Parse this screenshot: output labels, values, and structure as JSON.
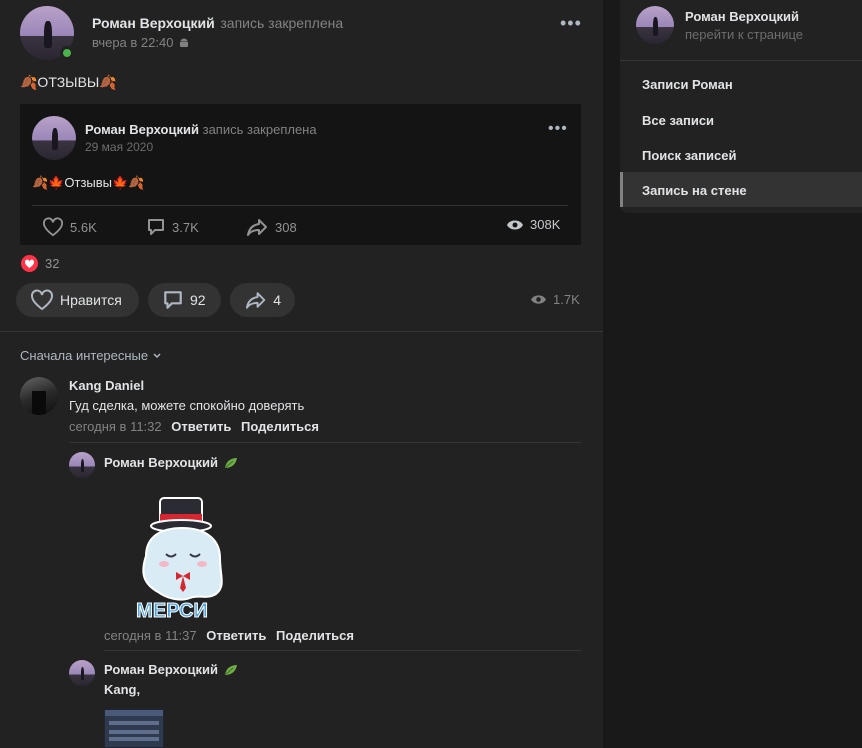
{
  "post": {
    "author": "Роман Верхоцкий",
    "action": "запись закреплена",
    "time": "вчера в 22:40",
    "text": "🍂ОТЗЫВЫ🍂",
    "repost": {
      "author": "Роман Верхоцкий",
      "action": "запись закреплена",
      "date": "29 мая 2020",
      "text": "🍂🍁Отзывы🍁🍂",
      "likes": "5.6K",
      "comments": "3.7K",
      "shares": "308",
      "views": "308K"
    },
    "reactions_count": "32",
    "like_label": "Нравится",
    "comments_count": "92",
    "shares_count": "4",
    "views": "1.7K"
  },
  "comments_section": {
    "sort_label": "Сначала интересные",
    "items": [
      {
        "author": "Kang Daniel",
        "text": "Гуд сделка, можете спокойно доверять",
        "time": "сегодня в 11:32",
        "reply_label": "Ответить",
        "share_label": "Поделиться"
      },
      {
        "author": "Роман Верхоцкий",
        "sticker_text": "МЕРСИ",
        "time": "сегодня в 11:37",
        "reply_label": "Ответить",
        "share_label": "Поделиться"
      },
      {
        "author": "Роман Верхоцкий",
        "text": "Kang,"
      }
    ]
  },
  "sidebar": {
    "profile_name": "Роман Верхоцкий",
    "profile_link": "перейти к странице",
    "items": [
      {
        "label": "Записи Роман"
      },
      {
        "label": "Все записи"
      },
      {
        "label": "Поиск записей"
      },
      {
        "label": "Запись на стене"
      }
    ]
  },
  "colors": {
    "background": "#19191a",
    "card": "#222222",
    "online": "#4bb34b",
    "heart": "#ff3347"
  }
}
